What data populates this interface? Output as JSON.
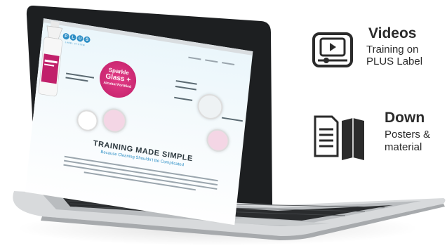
{
  "videos": {
    "title": "Videos",
    "line1": "Training on",
    "line2": "PLUS Label"
  },
  "downloads": {
    "title": "Down",
    "line1": "Posters &",
    "line2": "material"
  },
  "website": {
    "logo_letters": [
      "P",
      "L",
      "U",
      "S"
    ],
    "logo_sub": "LABEL SYSTEM",
    "badge_line1": "Sparkle",
    "badge_line2": "Glass +",
    "badge_line3": "Alcohol Fortified",
    "headline": "TRAINING MADE SIMPLE",
    "subhead": "Because Cleaning Shouldn't Be Complicated"
  },
  "colors": {
    "accent_pink": "#c1206a",
    "accent_blue": "#2f8fc6",
    "icon_dark": "#2b2b2b"
  },
  "icons": {
    "video": "video-player-icon",
    "download": "documents-icon"
  }
}
